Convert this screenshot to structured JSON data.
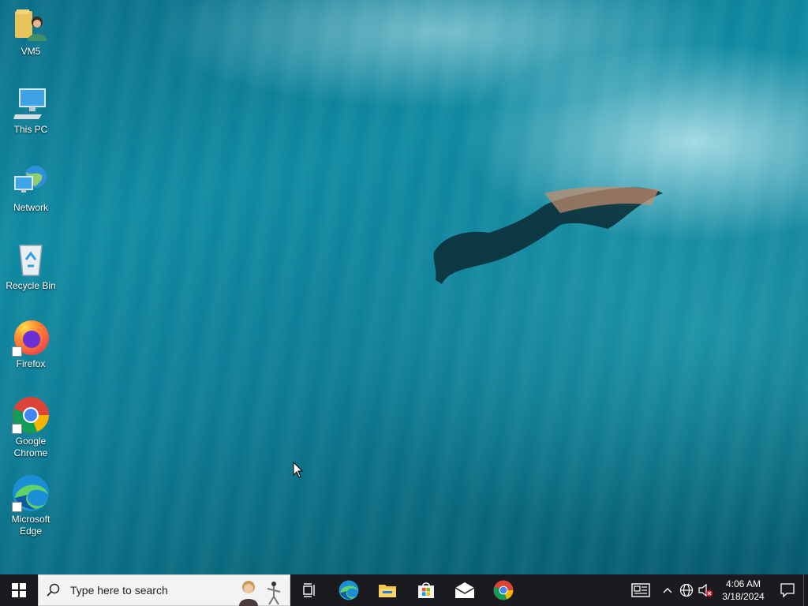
{
  "desktop": {
    "icons": [
      {
        "name": "vm5-folder",
        "label": "VM5"
      },
      {
        "name": "this-pc",
        "label": "This PC"
      },
      {
        "name": "network",
        "label": "Network"
      },
      {
        "name": "recycle-bin",
        "label": "Recycle Bin"
      },
      {
        "name": "firefox",
        "label": "Firefox"
      },
      {
        "name": "google-chrome",
        "label": "Google Chrome"
      },
      {
        "name": "microsoft-edge",
        "label": "Microsoft Edge"
      }
    ]
  },
  "taskbar": {
    "search_placeholder": "Type here to search",
    "pinned": [
      "task-view-icon",
      "edge-icon",
      "file-explorer-icon",
      "store-icon",
      "mail-icon",
      "chrome-icon"
    ],
    "clock": {
      "time": "4:06 AM",
      "date": "3/18/2024"
    }
  },
  "colors": {
    "taskbar_bg": "#1b1b1f",
    "desktop_bg": "#0d7d96",
    "windows_blue": "#ffffff"
  }
}
